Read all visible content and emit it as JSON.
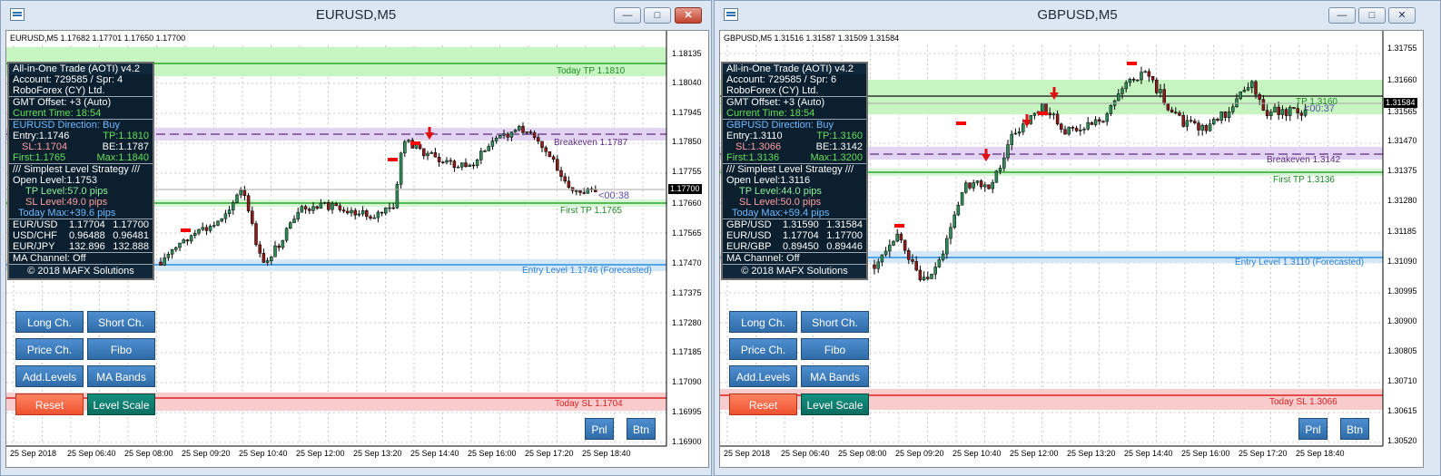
{
  "windows": [
    {
      "id": "eurusd",
      "title": "EURUSD,M5",
      "symbol_header": "EURUSD,M5  1.17682 1.17701 1.17650 1.17700",
      "panel": {
        "title": "All-in-One Trade (AOTI) v4.2",
        "account": "Account: 729585 / Spr: 4",
        "broker": "RoboForex (CY) Ltd.",
        "gmt": "GMT Offset: +3 (Auto)",
        "time": "Current Time: 18:54",
        "direction": "EURUSD Direction: Buy",
        "entry": "Entry:1.1746",
        "tp": "TP:1.1810",
        "sl": "SL:1.1704",
        "be": "BE:1.1787",
        "first": "First:1.1765",
        "max": "Max:1.1840",
        "strategy": "/// Simplest Level Strategy ///",
        "open_level": "Open Level:1.1753",
        "tp_level": "TP Level:57.0 pips",
        "sl_level": "SL Level:49.0 pips",
        "today_max": "Today Max:+39.6 pips",
        "quotes": [
          {
            "pair": "EUR/USD",
            "bid": "1.17704",
            "ask": "1.17700"
          },
          {
            "pair": "USD/CHF",
            "bid": "0.96488",
            "ask": "0.96481"
          },
          {
            "pair": "EUR/JPY",
            "bid": "132.896",
            "ask": "132.888"
          }
        ],
        "ma_channel": "MA Channel: Off",
        "copyright": "© 2018 MAFX Solutions"
      },
      "buttons": {
        "long": "Long Ch.",
        "short": "Short Ch.",
        "price": "Price Ch.",
        "fibo": "Fibo",
        "add_levels": "Add.Levels",
        "ma_bands": "MA Bands",
        "reset": "Reset",
        "level_scale": "Level Scale",
        "pnl": "Pnl",
        "btn": "Btn"
      },
      "levels": {
        "today_tp": "Today TP 1.1810",
        "breakeven": "Breakeven 1.1787",
        "first_tp": "First TP 1.1765",
        "entry": "Entry Level 1.1746 (Forecasted)",
        "today_sl": "Today SL 1.1704"
      },
      "countdown": "<00:38",
      "current_price": "1.17700",
      "price_axis": [
        "1.18135",
        "1.18040",
        "1.17945",
        "1.17850",
        "1.17755",
        "1.17660",
        "1.17565",
        "1.17470",
        "1.17375",
        "1.17280",
        "1.17185",
        "1.17090",
        "1.16995",
        "1.16900"
      ],
      "time_axis": [
        "25 Sep 2018",
        "25 Sep 06:40",
        "25 Sep 08:00",
        "25 Sep 09:20",
        "25 Sep 10:40",
        "25 Sep 12:00",
        "25 Sep 13:20",
        "25 Sep 14:40",
        "25 Sep 16:00",
        "25 Sep 17:20",
        "25 Sep 18:40"
      ]
    },
    {
      "id": "gbpusd",
      "title": "GBPUSD,M5",
      "symbol_header": "GBPUSD,M5  1.31516 1.31587 1.31509 1.31584",
      "panel": {
        "title": "All-in-One Trade (AOTI) v4.2",
        "account": "Account: 729585 / Spr: 6",
        "broker": "RoboForex (CY) Ltd.",
        "gmt": "GMT Offset: +3 (Auto)",
        "time": "Current Time: 18:54",
        "direction": "GBPUSD Direction: Buy",
        "entry": "Entry:1.3110",
        "tp": "TP:1.3160",
        "sl": "SL:1.3066",
        "be": "BE:1.3142",
        "first": "First:1.3136",
        "max": "Max:1.3200",
        "strategy": "/// Simplest Level Strategy ///",
        "open_level": "Open Level:1.3116",
        "tp_level": "TP Level:44.0 pips",
        "sl_level": "SL Level:50.0 pips",
        "today_max": "Today Max:+59.4 pips",
        "quotes": [
          {
            "pair": "GBP/USD",
            "bid": "1.31590",
            "ask": "1.31584"
          },
          {
            "pair": "EUR/USD",
            "bid": "1.17704",
            "ask": "1.17700"
          },
          {
            "pair": "EUR/GBP",
            "bid": "0.89450",
            "ask": "0.89446"
          }
        ],
        "ma_channel": "MA Channel: Off",
        "copyright": "© 2018 MAFX Solutions"
      },
      "buttons": {
        "long": "Long Ch.",
        "short": "Short Ch.",
        "price": "Price Ch.",
        "fibo": "Fibo",
        "add_levels": "Add.Levels",
        "ma_bands": "MA Bands",
        "reset": "Reset",
        "level_scale": "Level Scale",
        "pnl": "Pnl",
        "btn": "Btn"
      },
      "levels": {
        "today_tp": "TP 1.3160",
        "breakeven": "Breakeven 1.3142",
        "first_tp": "First TP 1.3136",
        "entry": "Entry Level 1.3110 (Forecasted)",
        "today_sl": "Today SL 1.3066"
      },
      "countdown": "<00:37",
      "current_price": "1.31584",
      "price_axis": [
        "1.31755",
        "1.31660",
        "1.31565",
        "1.31470",
        "1.31375",
        "1.31280",
        "1.31185",
        "1.31090",
        "1.30995",
        "1.30900",
        "1.30805",
        "1.30710",
        "1.30615",
        "1.30520"
      ],
      "time_axis": [
        "25 Sep 2018",
        "25 Sep 06:40",
        "25 Sep 08:00",
        "25 Sep 09:20",
        "25 Sep 10:40",
        "25 Sep 12:00",
        "25 Sep 13:20",
        "25 Sep 14:40",
        "25 Sep 16:00",
        "25 Sep 17:20",
        "25 Sep 18:40"
      ]
    }
  ]
}
